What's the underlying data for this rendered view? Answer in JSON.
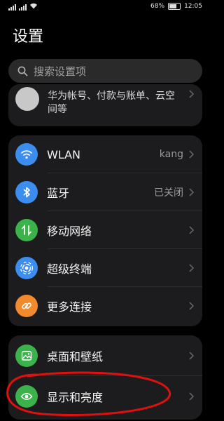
{
  "status": {
    "battery": "68%",
    "time": "12:05",
    "battery_level": 0.68
  },
  "page": {
    "title": "设置"
  },
  "search": {
    "placeholder": "搜索设置项"
  },
  "account": {
    "text": "华为帐号、付款与账单、云空间等"
  },
  "group1": {
    "items": [
      {
        "label": "WLAN",
        "value": "kang",
        "icon": "wifi-icon",
        "color": "#3b8df0"
      },
      {
        "label": "蓝牙",
        "value": "已关闭",
        "icon": "bluetooth-icon",
        "color": "#3b8df0"
      },
      {
        "label": "移动网络",
        "value": "",
        "icon": "mobile-network-icon",
        "color": "#3cb24a"
      },
      {
        "label": "超级终端",
        "value": "",
        "icon": "super-device-icon",
        "color": "#3b8df0"
      },
      {
        "label": "更多连接",
        "value": "",
        "icon": "link-icon",
        "color": "#f08a2c"
      }
    ]
  },
  "group2": {
    "items": [
      {
        "label": "桌面和壁纸",
        "icon": "wallpaper-icon",
        "color": "#3cb24a"
      },
      {
        "label": "显示和亮度",
        "icon": "eye-icon",
        "color": "#3cb24a"
      }
    ]
  },
  "annotation_color": "#e01010"
}
